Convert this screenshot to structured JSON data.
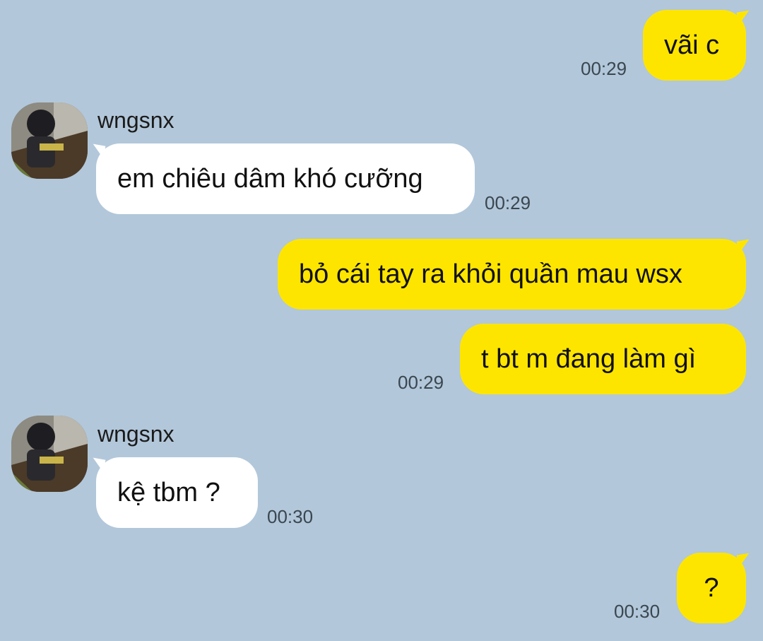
{
  "messages": [
    {
      "sender": "me",
      "text": "vãi c",
      "time": "00:29"
    },
    {
      "sender": "wngsnx",
      "text": "em chiêu dâm khó cưỡng",
      "time": "00:29"
    },
    {
      "sender": "me",
      "text": "bỏ cái tay ra khỏi quần mau wsx",
      "time": ""
    },
    {
      "sender": "me",
      "text": "t bt m đang làm gì",
      "time": "00:29"
    },
    {
      "sender": "wngsnx",
      "text": "kệ tbm ?",
      "time": "00:30"
    },
    {
      "sender": "me",
      "text": "?",
      "time": "00:30"
    }
  ],
  "contact": {
    "name": "wngsnx",
    "avatar_icon": "profile-photo-avatar"
  },
  "colors": {
    "background": "#b2c7da",
    "my_bubble": "#fee500",
    "their_bubble": "#ffffff"
  }
}
